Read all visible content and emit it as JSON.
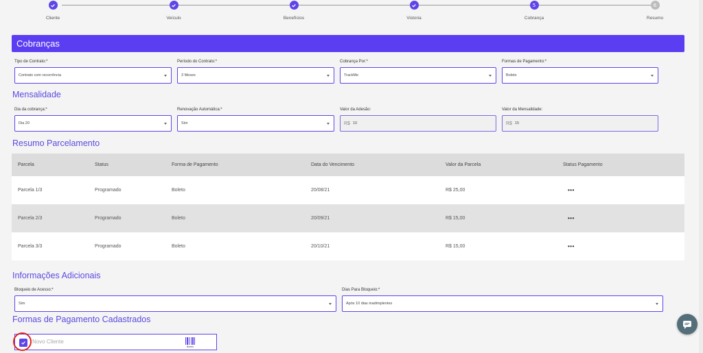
{
  "stepper": {
    "steps": [
      {
        "label": "Cliente",
        "state": "done",
        "number": ""
      },
      {
        "label": "Veículo",
        "state": "done",
        "number": ""
      },
      {
        "label": "Benefícios",
        "state": "done",
        "number": ""
      },
      {
        "label": "Vistoria",
        "state": "done",
        "number": ""
      },
      {
        "label": "Cobrança",
        "state": "active",
        "number": "5"
      },
      {
        "label": "Resumo",
        "state": "inactive",
        "number": "6"
      }
    ]
  },
  "header": {
    "title": "Cobranças"
  },
  "contract": {
    "tipo_label": "Tipo de Contrato:*",
    "tipo_value": "Contrato com recorrência",
    "periodo_label": "Período do Contrato:*",
    "periodo_value": "3 Meses",
    "cobranca_label": "Cobrança Por:*",
    "cobranca_value": "TrackMe",
    "formas_label": "Formas de Pagamento:*",
    "formas_value": "Boleto"
  },
  "mensalidade": {
    "title": "Mensalidade",
    "dia_label": "Dia da cobrança:*",
    "dia_value": "Dia 20",
    "renovacao_label": "Renovação Automática:*",
    "renovacao_value": "Sim",
    "adesao_label": "Valor da Adesão:",
    "adesao_prefix": "R$",
    "adesao_value": "10",
    "mensalidade_label": "Valor da Mensalidade:",
    "mensalidade_prefix": "R$",
    "mensalidade_value": "15"
  },
  "resumo": {
    "title": "Resumo Parcelamento",
    "columns": [
      "Parcela",
      "Status",
      "Forma de Pagamento",
      "Data do Vencimento",
      "Valor da Parcela",
      "Status Pagamento"
    ],
    "rows": [
      {
        "parcela": "Parcela 1/3",
        "status": "Programado",
        "forma": "Boleto",
        "data": "20/08/21",
        "valor": "R$ 25,00",
        "action": "•••"
      },
      {
        "parcela": "Parcela 2/3",
        "status": "Programado",
        "forma": "Boleto",
        "data": "20/09/21",
        "valor": "R$ 15,00",
        "action": "•••"
      },
      {
        "parcela": "Parcela 3/3",
        "status": "Programado",
        "forma": "Boleto",
        "data": "20/10/21",
        "valor": "R$ 15,00",
        "action": "•••"
      }
    ]
  },
  "adicionais": {
    "title": "Informações Adicionais",
    "bloqueio_label": "Bloqueio de Acesso:*",
    "bloqueio_value": "Sim",
    "dias_label": "Dias Para Bloqueio:*",
    "dias_value": "Após 10 dias inadimplentes"
  },
  "formas_cadastradas": {
    "title": "Formas de Pagamento Cadastrados",
    "item_label": "Novo Cliente",
    "item_icon_label": "Boleto"
  },
  "colors": {
    "accent": "#5b3df2",
    "highlight": "#e02424",
    "chat": "#546e7a"
  }
}
